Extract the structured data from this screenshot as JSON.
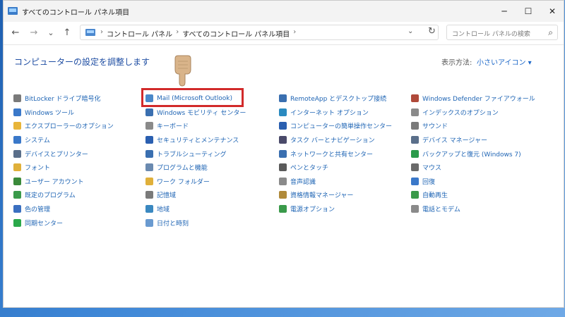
{
  "window": {
    "title": "すべてのコントロール パネル項目",
    "minimize": "─",
    "maximize": "☐",
    "close": "✕"
  },
  "toolbar": {
    "back": "←",
    "forward": "→",
    "history": "⌄",
    "up": "↑",
    "breadcrumb": [
      "コントロール パネル",
      "すべてのコントロール パネル項目"
    ],
    "dropdown": "⌄",
    "refresh": "↻",
    "search_placeholder": "コントロール パネルの検索",
    "search_icon": "🔍"
  },
  "main": {
    "heading": "コンピューターの設定を調整します",
    "view_by_label": "表示方法:",
    "view_by_value": "小さいアイコン ▾"
  },
  "columns": [
    {
      "items": [
        {
          "label": "BitLocker ドライブ暗号化",
          "color": "#7a7a7a"
        },
        {
          "label": "Windows ツール",
          "color": "#3a78c9"
        },
        {
          "label": "エクスプローラーのオプション",
          "color": "#e8b53a"
        },
        {
          "label": "システム",
          "color": "#3a78c9"
        },
        {
          "label": "デバイスとプリンター",
          "color": "#5a6f8a"
        },
        {
          "label": "フォント",
          "color": "#e0b03a"
        },
        {
          "label": "ユーザー アカウント",
          "color": "#3a8a3a"
        },
        {
          "label": "既定のプログラム",
          "color": "#3a9a4a"
        },
        {
          "label": "色の管理",
          "color": "#3a6fc0"
        },
        {
          "label": "同期センター",
          "color": "#2aa84a"
        }
      ]
    },
    {
      "items": [
        {
          "label": "Mail (Microsoft Outlook)",
          "color": "#4a88c9"
        },
        {
          "label": "Windows モビリティ センター",
          "color": "#3a6fb0"
        },
        {
          "label": "キーボード",
          "color": "#8a8a8a"
        },
        {
          "label": "セキュリティとメンテナンス",
          "color": "#2a5fb0"
        },
        {
          "label": "トラブルシューティング",
          "color": "#3a6fb0"
        },
        {
          "label": "プログラムと機能",
          "color": "#6a8ab0"
        },
        {
          "label": "ワーク フォルダー",
          "color": "#e0b03a"
        },
        {
          "label": "記憶域",
          "color": "#7a7a7a"
        },
        {
          "label": "地域",
          "color": "#3a88c0"
        },
        {
          "label": "日付と時刻",
          "color": "#6a9ad0"
        }
      ]
    },
    {
      "items": [
        {
          "label": "RemoteApp とデスクトップ接続",
          "color": "#3a6fb0"
        },
        {
          "label": "インターネット オプション",
          "color": "#2a8ac0"
        },
        {
          "label": "コンピューターの簡単操作センター",
          "color": "#2a5fb0"
        },
        {
          "label": "タスク バーとナビゲーション",
          "color": "#4a4a6a"
        },
        {
          "label": "ネットワークと共有センター",
          "color": "#3a6fb0"
        },
        {
          "label": "ペンとタッチ",
          "color": "#5a5a5a"
        },
        {
          "label": "音声認識",
          "color": "#8a8a8a"
        },
        {
          "label": "資格情報マネージャー",
          "color": "#b08a3a"
        },
        {
          "label": "電源オプション",
          "color": "#3a9a4a"
        }
      ]
    },
    {
      "items": [
        {
          "label": "Windows Defender ファイアウォール",
          "color": "#b04a3a"
        },
        {
          "label": "インデックスのオプション",
          "color": "#8a8a8a"
        },
        {
          "label": "サウンド",
          "color": "#7a7a7a"
        },
        {
          "label": "デバイス マネージャー",
          "color": "#5a6f8a"
        },
        {
          "label": "バックアップと復元 (Windows 7)",
          "color": "#2a9a4a"
        },
        {
          "label": "マウス",
          "color": "#6a6a6a"
        },
        {
          "label": "回復",
          "color": "#3a78c9"
        },
        {
          "label": "自動再生",
          "color": "#3a9a4a"
        },
        {
          "label": "電話とモデム",
          "color": "#8a8a8a"
        }
      ]
    }
  ],
  "colors": {
    "link": "#1e64b4",
    "highlight_border": "#d22a2a",
    "heading": "#1f4ea3"
  }
}
